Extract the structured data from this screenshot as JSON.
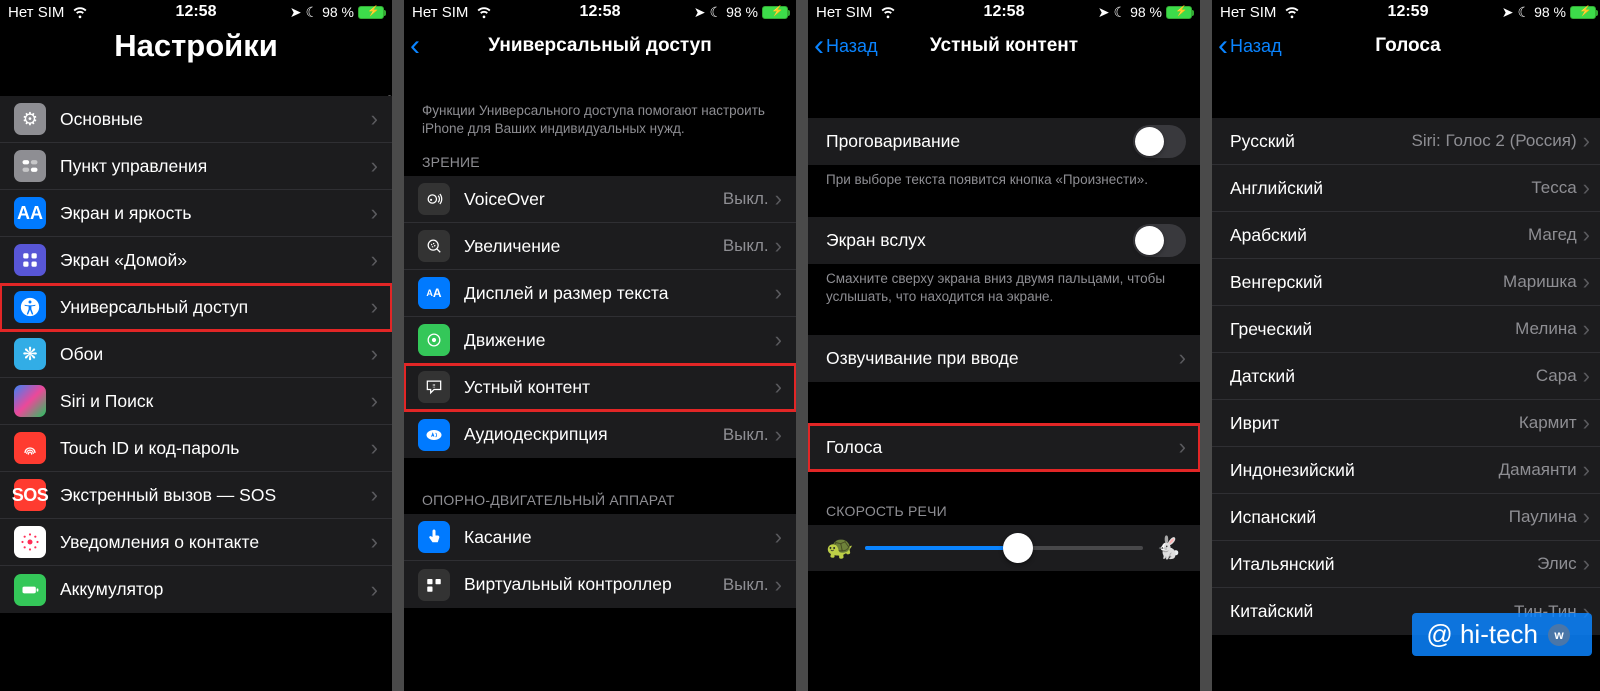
{
  "status": {
    "carrier": "Нет SIM",
    "time1": "12:58",
    "time4": "12:59",
    "battery": "98 %"
  },
  "s1": {
    "title": "Настройки",
    "items": [
      {
        "label": "Основные"
      },
      {
        "label": "Пункт управления"
      },
      {
        "label": "Экран и яркость"
      },
      {
        "label": "Экран «Домой»"
      },
      {
        "label": "Универсальный доступ",
        "hl": true
      },
      {
        "label": "Обои"
      },
      {
        "label": "Siri и Поиск"
      },
      {
        "label": "Touch ID и код-пароль"
      },
      {
        "label": "Экстренный вызов — SOS"
      },
      {
        "label": "Уведомления о контакте"
      },
      {
        "label": "Аккумулятор"
      }
    ]
  },
  "s2": {
    "title": "Универсальный доступ",
    "intro": "Функции Универсального доступа помогают настроить iPhone для Ваших индивидуальных нужд.",
    "group1": "ЗРЕНИЕ",
    "group2": "ОПОРНО-ДВИГАТЕЛЬНЫЙ АППАРАТ",
    "items1": [
      {
        "label": "VoiceOver",
        "value": "Выкл."
      },
      {
        "label": "Увеличение",
        "value": "Выкл."
      },
      {
        "label": "Дисплей и размер текста"
      },
      {
        "label": "Движение"
      },
      {
        "label": "Устный контент",
        "hl": true
      },
      {
        "label": "Аудиодескрипция",
        "value": "Выкл."
      }
    ],
    "items2": [
      {
        "label": "Касание"
      },
      {
        "label": "Виртуальный контроллер",
        "value": "Выкл."
      }
    ]
  },
  "s3": {
    "back": "Назад",
    "title": "Устный контент",
    "toggle1": "Проговаривание",
    "note1": "При выборе текста появится кнопка «Произнести».",
    "toggle2": "Экран вслух",
    "note2": "Смахните сверху экрана вниз двумя пальцами, чтобы услышать, что находится на экране.",
    "row1": "Озвучивание при вводе",
    "row2": "Голоса",
    "speed_header": "СКОРОСТЬ РЕЧИ"
  },
  "s4": {
    "back": "Назад",
    "title": "Голоса",
    "items": [
      {
        "label": "Русский",
        "value": "Siri: Голос 2 (Россия)"
      },
      {
        "label": "Английский",
        "value": "Тесса"
      },
      {
        "label": "Арабский",
        "value": "Магед"
      },
      {
        "label": "Венгерский",
        "value": "Маришка"
      },
      {
        "label": "Греческий",
        "value": "Мелина"
      },
      {
        "label": "Датский",
        "value": "Сара"
      },
      {
        "label": "Иврит",
        "value": "Кармит"
      },
      {
        "label": "Индонезийский",
        "value": "Дамаянти"
      },
      {
        "label": "Испанский",
        "value": "Паулина"
      },
      {
        "label": "Итальянский",
        "value": "Элис"
      },
      {
        "label": "Китайский",
        "value": "Тин-Тин"
      }
    ]
  },
  "watermark": "@ hi-tech"
}
